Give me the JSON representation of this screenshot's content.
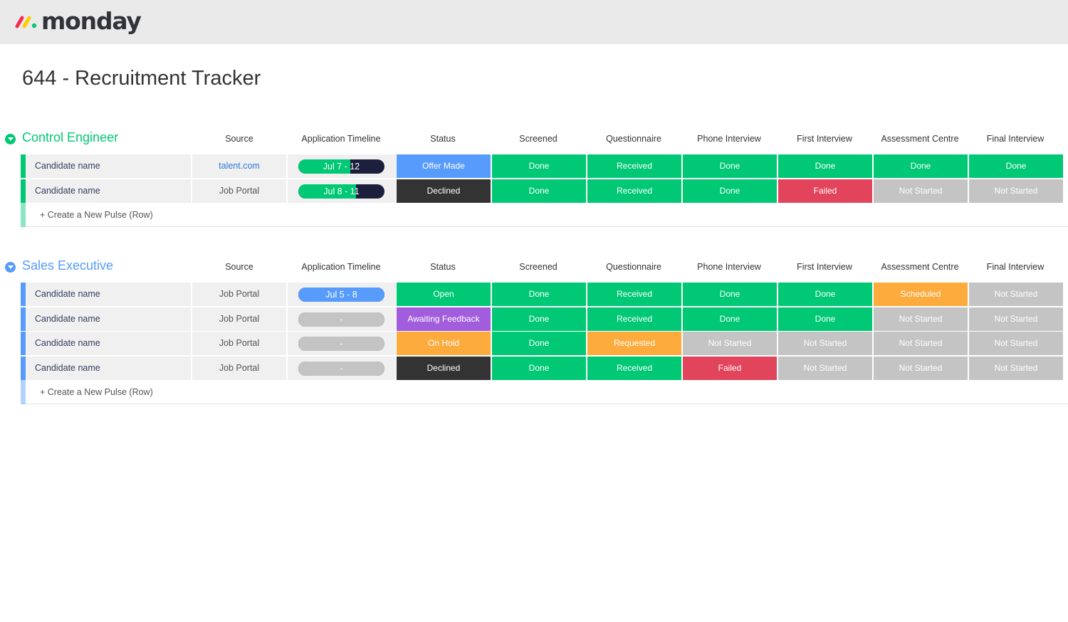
{
  "app": {
    "logo_text": "monday",
    "board_title": "644 - Recruitment Tracker"
  },
  "columns": [
    "Source",
    "Application Timeline",
    "Status",
    "Screened",
    "Questionnaire",
    "Phone Interview",
    "First Interview",
    "Assessment Centre",
    "Final Interview"
  ],
  "colors": {
    "green": "#00c875",
    "blue": "#579bfc",
    "black": "#333333",
    "red": "#e2445c",
    "grey": "#c4c4c4",
    "orange": "#fdab3d",
    "purple": "#a25ddc",
    "group_green": "#00c875",
    "group_blue": "#579bfc",
    "timeline_dark": "#1c1f3b",
    "timeline_empty": "#c4c4c4"
  },
  "groups": [
    {
      "title": "Control Engineer",
      "color": "#00c875",
      "create_label": "+ Create a New Pulse (Row)",
      "rows": [
        {
          "name": "Candidate name",
          "source": "talent.com",
          "timeline": "Jul 7 - 12",
          "timeline_color": "#00c875",
          "timeline_progress": 0.6,
          "status": "Offer Made",
          "status_color": "#579bfc",
          "cells": [
            {
              "label": "Done",
              "color": "#00c875"
            },
            {
              "label": "Received",
              "color": "#00c875"
            },
            {
              "label": "Done",
              "color": "#00c875"
            },
            {
              "label": "Done",
              "color": "#00c875"
            },
            {
              "label": "Done",
              "color": "#00c875"
            },
            {
              "label": "Done",
              "color": "#00c875"
            }
          ]
        },
        {
          "name": "Candidate name",
          "source": "Job Portal",
          "timeline": "Jul 8 - 11",
          "timeline_color": "#00c875",
          "timeline_progress": 0.67,
          "status": "Declined",
          "status_color": "#333333",
          "cells": [
            {
              "label": "Done",
              "color": "#00c875"
            },
            {
              "label": "Received",
              "color": "#00c875"
            },
            {
              "label": "Done",
              "color": "#00c875"
            },
            {
              "label": "Failed",
              "color": "#e2445c"
            },
            {
              "label": "Not Started",
              "color": "#c4c4c4"
            },
            {
              "label": "Not Started",
              "color": "#c4c4c4"
            }
          ]
        }
      ]
    },
    {
      "title": "Sales Executive",
      "color": "#579bfc",
      "create_label": "+ Create a New Pulse (Row)",
      "rows": [
        {
          "name": "Candidate name",
          "source": "Job Portal",
          "timeline": "Jul 5 - 8",
          "timeline_color": "#579bfc",
          "timeline_progress": 1,
          "status": "Open",
          "status_color": "#00c875",
          "cells": [
            {
              "label": "Done",
              "color": "#00c875"
            },
            {
              "label": "Received",
              "color": "#00c875"
            },
            {
              "label": "Done",
              "color": "#00c875"
            },
            {
              "label": "Done",
              "color": "#00c875"
            },
            {
              "label": "Scheduled",
              "color": "#fdab3d"
            },
            {
              "label": "Not Started",
              "color": "#c4c4c4"
            }
          ]
        },
        {
          "name": "Candidate name",
          "source": "Job Portal",
          "timeline": "-",
          "timeline_color": "#c4c4c4",
          "timeline_progress": 1,
          "status": "Awaiting Feedback",
          "status_color": "#a25ddc",
          "cells": [
            {
              "label": "Done",
              "color": "#00c875"
            },
            {
              "label": "Received",
              "color": "#00c875"
            },
            {
              "label": "Done",
              "color": "#00c875"
            },
            {
              "label": "Done",
              "color": "#00c875"
            },
            {
              "label": "Not Started",
              "color": "#c4c4c4"
            },
            {
              "label": "Not Started",
              "color": "#c4c4c4"
            }
          ]
        },
        {
          "name": "Candidate name",
          "source": "Job Portal",
          "timeline": "-",
          "timeline_color": "#c4c4c4",
          "timeline_progress": 1,
          "status": "On Hold",
          "status_color": "#fdab3d",
          "cells": [
            {
              "label": "Done",
              "color": "#00c875"
            },
            {
              "label": "Requested",
              "color": "#fdab3d"
            },
            {
              "label": "Not Started",
              "color": "#c4c4c4"
            },
            {
              "label": "Not Started",
              "color": "#c4c4c4"
            },
            {
              "label": "Not Started",
              "color": "#c4c4c4"
            },
            {
              "label": "Not Started",
              "color": "#c4c4c4"
            }
          ]
        },
        {
          "name": "Candidate name",
          "source": "Job Portal",
          "timeline": "-",
          "timeline_color": "#c4c4c4",
          "timeline_progress": 1,
          "status": "Declined",
          "status_color": "#333333",
          "cells": [
            {
              "label": "Done",
              "color": "#00c875"
            },
            {
              "label": "Received",
              "color": "#00c875"
            },
            {
              "label": "Failed",
              "color": "#e2445c"
            },
            {
              "label": "Not Started",
              "color": "#c4c4c4"
            },
            {
              "label": "Not Started",
              "color": "#c4c4c4"
            },
            {
              "label": "Not Started",
              "color": "#c4c4c4"
            }
          ]
        }
      ]
    }
  ]
}
